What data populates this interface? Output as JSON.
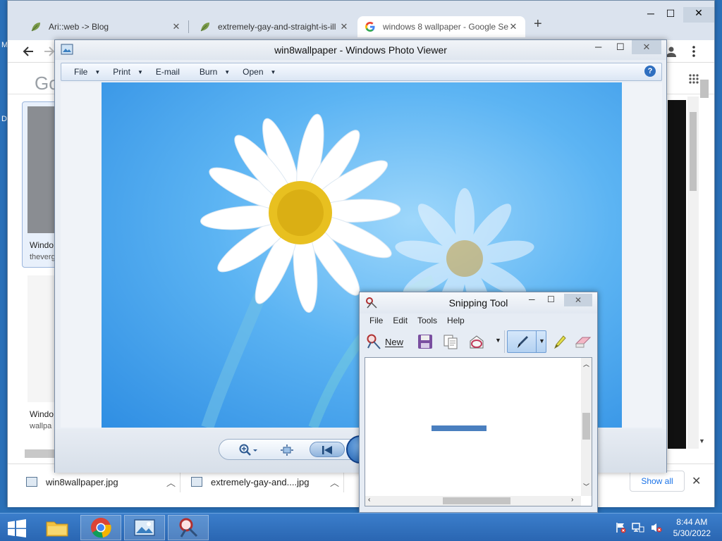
{
  "chrome": {
    "tabs": [
      {
        "label": "Ari::web -> Blog"
      },
      {
        "label": "extremely-gay-and-straight-is-ill"
      },
      {
        "label": "windows 8 wallpaper - Google Se"
      }
    ],
    "new_tab_glyph": "+",
    "close_glyph": "✕",
    "google_partial": "Go",
    "results": [
      {
        "title": "Windo",
        "source": "theverg"
      },
      {
        "title": "Windo",
        "source": "wallpa"
      }
    ],
    "downloads": [
      {
        "name": "win8wallpaper.jpg"
      },
      {
        "name": "extremely-gay-and....jpg"
      }
    ],
    "show_all": "Show all"
  },
  "photo_viewer": {
    "title": "win8wallpaper - Windows Photo Viewer",
    "menu": [
      {
        "label": "File",
        "has_dropdown": true
      },
      {
        "label": "Print",
        "has_dropdown": true
      },
      {
        "label": "E-mail",
        "has_dropdown": false
      },
      {
        "label": "Burn",
        "has_dropdown": true
      },
      {
        "label": "Open",
        "has_dropdown": true
      }
    ],
    "help_glyph": "?"
  },
  "snipping_tool": {
    "title": "Snipping Tool",
    "menu": [
      "File",
      "Edit",
      "Tools",
      "Help"
    ],
    "new_label": "New",
    "stroke_color": "#4a7fbf"
  },
  "taskbar": {
    "time": "8:44 AM",
    "date": "5/30/2022"
  },
  "desktop_edge": {
    "top_letter": "M",
    "mid_letter": "D"
  }
}
